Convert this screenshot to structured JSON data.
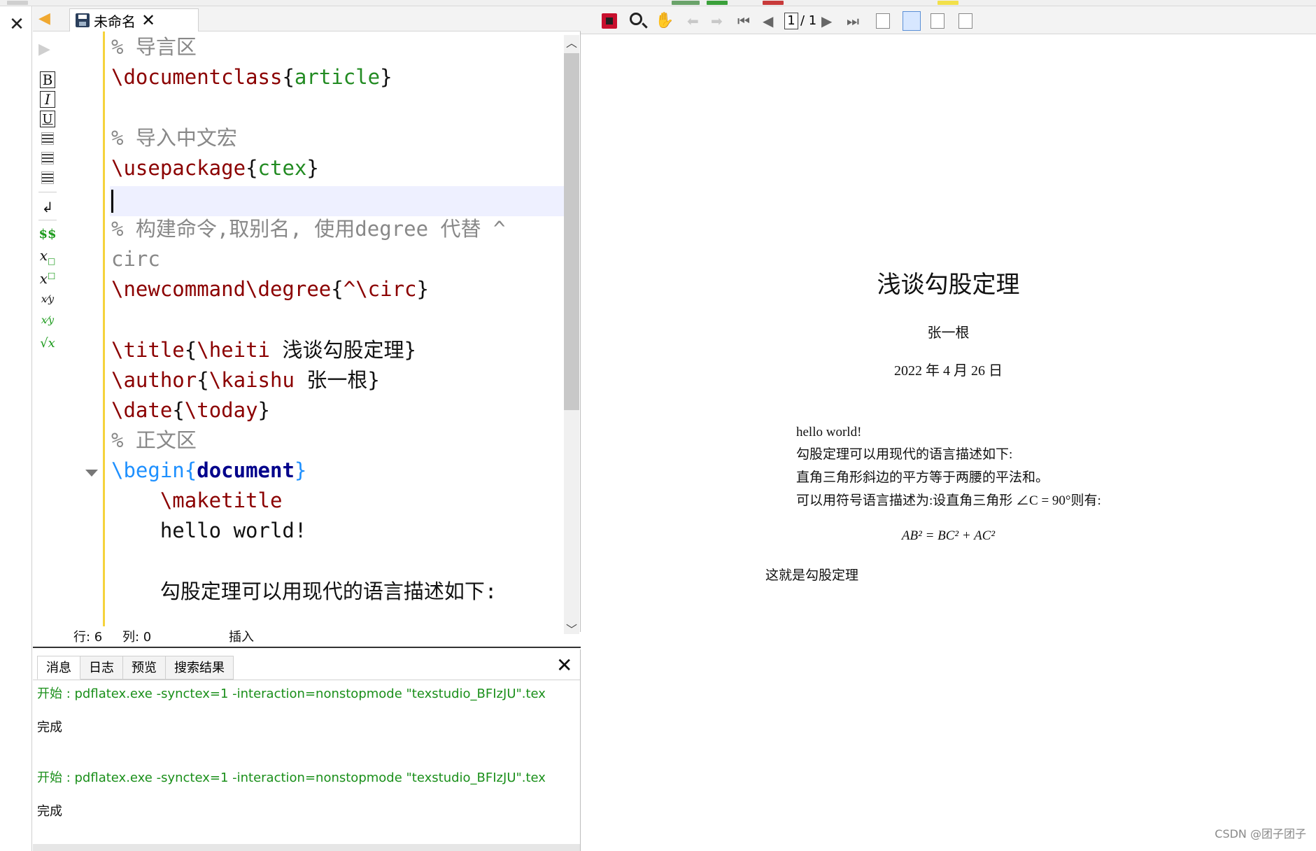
{
  "editor": {
    "tab_title": "未命名",
    "tab_close": "✕",
    "code": {
      "l1": "% 导言区",
      "l2_cmd": "\\documentclass",
      "l2_open": "{",
      "l2_arg": "article",
      "l2_close": "}",
      "l4": "% 导入中文宏",
      "l5_cmd": "\\usepackage",
      "l5_open": "{",
      "l5_arg": "ctex",
      "l5_close": "}",
      "l7": "% 构建命令,取别名, 使用degree 代替 ^",
      "l8": "circ",
      "l9_cmd": "\\newcommand\\degree",
      "l9_open": "{",
      "l9_arg": "^\\circ",
      "l9_close": "}",
      "l11_cmd1": "\\title",
      "l11_open": "{",
      "l11_cmd2": "\\heiti",
      "l11_text": " 浅谈勾股定理",
      "l11_close": "}",
      "l12_cmd1": "\\author",
      "l12_open": "{",
      "l12_cmd2": "\\kaishu",
      "l12_text": " 张一根",
      "l12_close": "}",
      "l13_cmd1": "\\date",
      "l13_open": "{",
      "l13_cmd2": "\\today",
      "l13_close": "}",
      "l14": "% 正文区",
      "l15_cmd": "\\begin",
      "l15_open": "{",
      "l15_arg": "document",
      "l15_close": "}",
      "l16": "    \\maketitle",
      "l17": "    hello world!",
      "l19": "    勾股定理可以用现代的语言描述如下:"
    }
  },
  "toolbar_left": {
    "bold": "B",
    "italic": "I",
    "underline": "U",
    "math": "$$",
    "subscript": "x",
    "superscript": "x",
    "sqrt": "√x"
  },
  "status": {
    "row_label": "行: ",
    "row_value": "6",
    "col_label": "列: ",
    "col_value": "0",
    "mode": "插入"
  },
  "messages": {
    "tabs": [
      "消息",
      "日志",
      "预览",
      "搜索结果"
    ],
    "close": "✕",
    "lines": [
      "开始 : pdflatex.exe -synctex=1 -interaction=nonstopmode \"texstudio_BFIzJU\".tex",
      "完成",
      "开始 : pdflatex.exe -synctex=1 -interaction=nonstopmode \"texstudio_BFIzJU\".tex",
      "完成"
    ]
  },
  "pdf": {
    "page_current": "1",
    "page_total": "/ 1",
    "title": "浅谈勾股定理",
    "author": "张一根",
    "date": "2022 年 4 月 26 日",
    "paragraphs": [
      "hello world!",
      "勾股定理可以用现代的语言描述如下:",
      "直角三角形斜边的平方等于两腰的平法和。",
      "可以用符号语言描述为:设直角三角形 ∠C = 90°则有:"
    ],
    "formula": "AB² = BC² + AC²",
    "closing": "这就是勾股定理"
  },
  "watermark": "CSDN @团子团子"
}
